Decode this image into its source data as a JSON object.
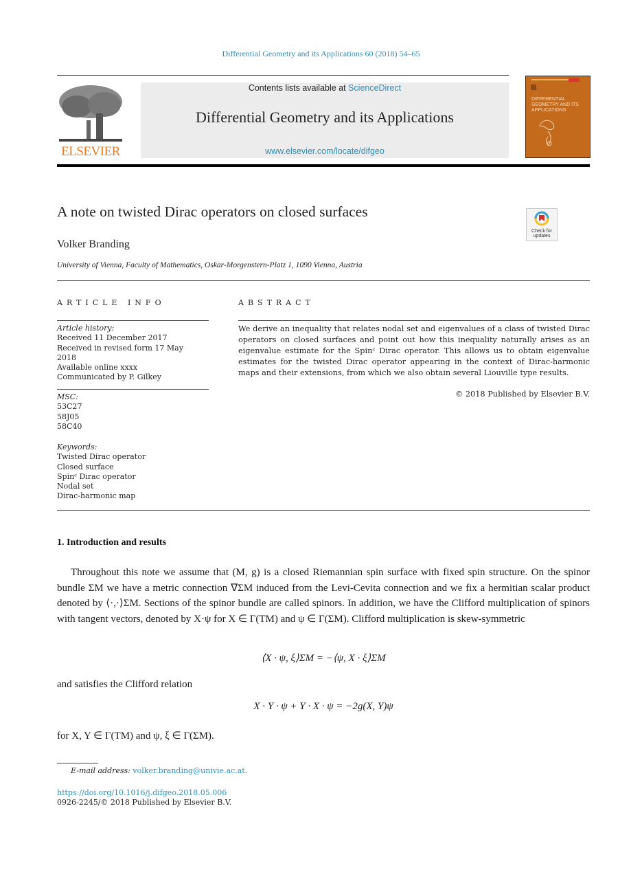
{
  "running_head": "Differential Geometry and its Applications 60 (2018) 54–65",
  "masthead": {
    "contents_prefix": "Contents lists available at ",
    "contents_link": "ScienceDirect",
    "journal_title": "Differential Geometry and its Applications",
    "journal_url": "www.elsevier.com/locate/difgeo",
    "publisher_logo_text": "ELSEVIER",
    "cover_title": "DIFFERENTIAL GEOMETRY AND ITS APPLICATIONS"
  },
  "crossmark": {
    "label_line1": "Check for",
    "label_line2": "updates"
  },
  "article": {
    "title": "A note on twisted Dirac operators on closed surfaces",
    "author": "Volker Branding",
    "affiliation": "University of Vienna, Faculty of Mathematics, Oskar-Morgenstern-Platz 1, 1090 Vienna, Austria"
  },
  "article_info": {
    "heading": "ARTICLE INFO",
    "history_label": "Article history:",
    "history": [
      "Received 11 December 2017",
      "Received in revised form 17 May 2018",
      "Available online xxxx",
      "Communicated by P. Gilkey"
    ],
    "msc_label": "MSC:",
    "msc": [
      "53C27",
      "58J05",
      "58C40"
    ],
    "keywords_label": "Keywords:",
    "keywords": [
      "Twisted Dirac operator",
      "Closed surface",
      "Spinᶜ Dirac operator",
      "Nodal set",
      "Dirac-harmonic map"
    ]
  },
  "abstract": {
    "heading": "ABSTRACT",
    "text": "We derive an inequality that relates nodal set and eigenvalues of a class of twisted Dirac operators on closed surfaces and point out how this inequality naturally arises as an eigenvalue estimate for the Spinᶜ Dirac operator. This allows us to obtain eigenvalue estimates for the twisted Dirac operator appearing in the context of Dirac-harmonic maps and their extensions, from which we also obtain several Liouville type results.",
    "copyright": "© 2018 Published by Elsevier B.V."
  },
  "section": {
    "heading": "1.  Introduction and results",
    "intro_paragraph": "Throughout this note we assume that (M, g) is a closed Riemannian spin surface with fixed spin structure. On the spinor bundle ΣM we have a metric connection ∇ΣM induced from the Levi-Cevita connection and we fix a hermitian scalar product denoted by ⟨·,·⟩ΣM. Sections of the spinor bundle are called spinors. In addition, we have the Clifford multiplication of spinors with tangent vectors, denoted by X·ψ for X ∈ Γ(TM) and ψ ∈ Γ(ΣM). Clifford multiplication is skew-symmetric",
    "equation_skew": "⟨X · ψ, ξ⟩ΣM = −⟨ψ, X · ξ⟩ΣM",
    "clifford_intro": "and satisfies the Clifford relation",
    "equation_clifford": "X · Y · ψ + Y · X · ψ = −2g(X, Y)ψ",
    "for_line": "for X, Y ∈ Γ(TM) and ψ, ξ ∈ Γ(ΣM)."
  },
  "footer": {
    "email_label": "E-mail address:",
    "email": "volker.branding@univie.ac.at",
    "doi": "https://doi.org/10.1016/j.difgeo.2018.05.006",
    "issn_line": "0926-2245/© 2018 Published by Elsevier B.V."
  },
  "colors": {
    "link": "#2a8fbd",
    "elsevier_orange": "#f07a1a",
    "cover": "#c36a1c"
  }
}
